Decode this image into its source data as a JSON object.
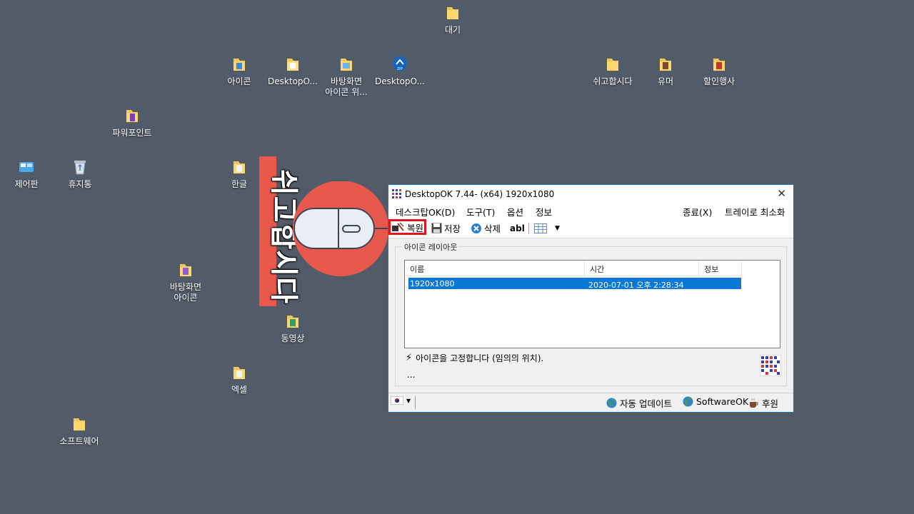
{
  "desktop": {
    "icons": [
      {
        "name": "folder-daegi",
        "label": "대기"
      },
      {
        "name": "folder-icon-label",
        "label": "아이콘"
      },
      {
        "name": "desktopok-folder",
        "label": "DesktopO..."
      },
      {
        "name": "wallpaper-icon-folder",
        "label": "바탕화면\n아이콘 위..."
      },
      {
        "name": "desktopok-zip",
        "label": "DesktopO..."
      },
      {
        "name": "folder-easy",
        "label": "쉬고합시다"
      },
      {
        "name": "folder-humor",
        "label": "유머"
      },
      {
        "name": "folder-sale",
        "label": "할인행사"
      },
      {
        "name": "powerpoint-folder",
        "label": "파워포인트"
      },
      {
        "name": "control-panel",
        "label": "제어판"
      },
      {
        "name": "recycle-bin",
        "label": "휴지통"
      },
      {
        "name": "hangul-folder",
        "label": "한글"
      },
      {
        "name": "wallpaper-icon-folder-2",
        "label": "바탕화면\n아이콘"
      },
      {
        "name": "video-folder",
        "label": "동영상"
      },
      {
        "name": "excel-folder",
        "label": "엑셀"
      },
      {
        "name": "software-folder",
        "label": "소프트웨어"
      }
    ]
  },
  "banner": {
    "text": "쉬고합시다",
    "color": "#e8584d"
  },
  "window": {
    "title": "DesktopOK 7.44- (x64) 1920x1080",
    "close_glyph": "✕",
    "menu": {
      "desktop": "데스크탑OK(D)",
      "tools": "도구(T)",
      "options": "옵션",
      "info": "정보",
      "exit": "종료(X)",
      "tray_minimize": "트레이로 최소화"
    },
    "toolbar": {
      "restore": "복원",
      "save": "저장",
      "delete": "삭제",
      "abl": "abl"
    },
    "group_label": "아이콘 레이아웃",
    "list": {
      "columns": [
        "이름",
        "시간",
        "정보"
      ],
      "rows": [
        {
          "name": "1920x1080",
          "time": "2020-07-01 오후 2:28:34",
          "info": ""
        }
      ]
    },
    "lock_text": "아이콘을 고정합니다 (임의의 위치).",
    "dots": "...",
    "status": {
      "auto_update": "자동 업데이트",
      "softwareok": "SoftwareOK",
      "donate": "후원"
    }
  },
  "colors": {
    "desktop": "#525b68",
    "selection": "#0a78d7",
    "highlight_border": "#e0141b"
  }
}
